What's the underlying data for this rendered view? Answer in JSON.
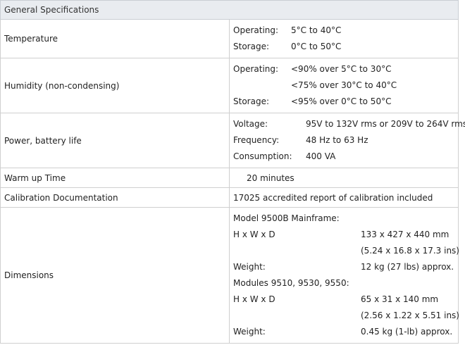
{
  "header": {
    "title": "General Specifications"
  },
  "temperature": {
    "label": "Temperature",
    "lines": [
      {
        "k": "Operating:",
        "v": "5°C to 40°C"
      },
      {
        "k": "Storage:",
        "v": "0°C to 50°C"
      }
    ]
  },
  "humidity": {
    "label": "Humidity (non-condensing)",
    "lines": [
      {
        "k": "Operating:",
        "v": "<90% over 5°C to 30°C"
      },
      {
        "k": "",
        "v": "<75% over 30°C to 40°C"
      },
      {
        "k": "Storage:",
        "v": "<95% over 0°C to 50°C"
      }
    ]
  },
  "power": {
    "label": "Power, battery life",
    "lines": [
      {
        "k": "Voltage:",
        "v": "95V to 132V rms or 209V to 264V rms"
      },
      {
        "k": "Frequency:",
        "v": "48 Hz to 63 Hz"
      },
      {
        "k": "Consumption:",
        "v": "400 VA"
      }
    ]
  },
  "warmup": {
    "label": "Warm up Time",
    "value": "20 minutes"
  },
  "calibration": {
    "label": "Calibration Documentation",
    "value": "17025 accredited report of calibration included"
  },
  "dimensions": {
    "label": "Dimensions",
    "mainframe_title": "Model 9500B Mainframe:",
    "mainframe": [
      {
        "k": "H x W x D",
        "v": "133 x 427 x 440 mm"
      },
      {
        "k": "",
        "v": "(5.24 x 16.8 x 17.3 ins)"
      },
      {
        "k": "Weight:",
        "v": "12 kg (27 lbs) approx."
      }
    ],
    "modules_title": "Modules 9510, 9530, 9550:",
    "modules": [
      {
        "k": "H x W x D",
        "v": "65 x 31 x 140 mm"
      },
      {
        "k": "",
        "v": "(2.56 x 1.22 x 5.51 ins)"
      },
      {
        "k": "Weight:",
        "v": "0.45 kg (1-lb) approx."
      }
    ]
  }
}
